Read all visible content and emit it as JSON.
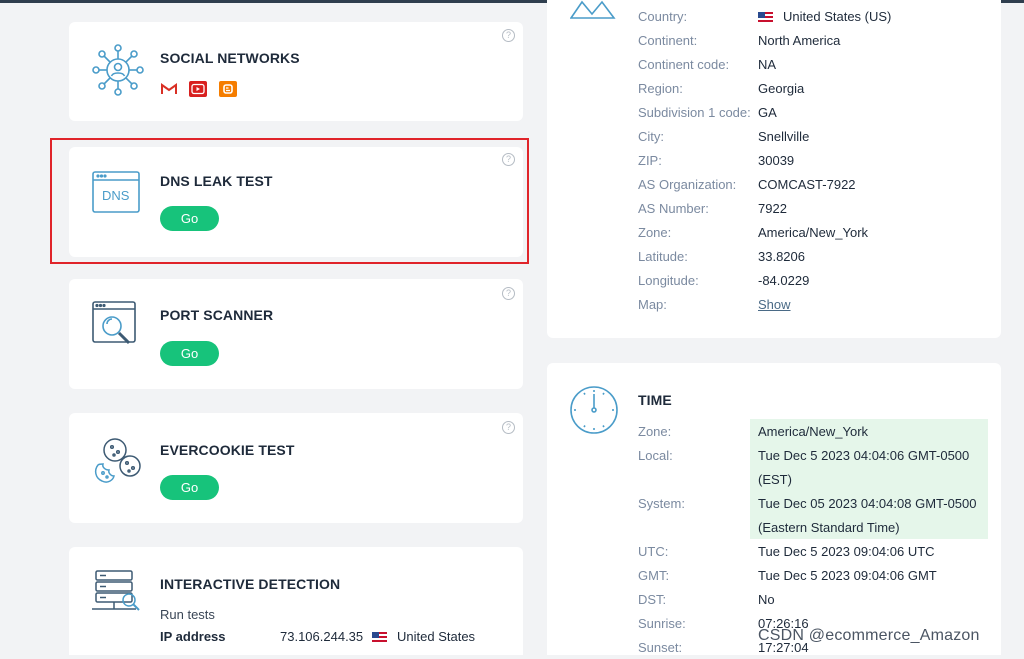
{
  "tools": {
    "social": {
      "title": "SOCIAL NETWORKS",
      "help": "?"
    },
    "dns": {
      "title": "DNS LEAK TEST",
      "icon_text": "DNS",
      "go": "Go",
      "help": "?"
    },
    "port": {
      "title": "PORT SCANNER",
      "go": "Go",
      "help": "?"
    },
    "evercookie": {
      "title": "EVERCOOKIE TEST",
      "go": "Go",
      "help": "?"
    },
    "interactive": {
      "title": "INTERACTIVE DETECTION",
      "subtitle": "Run tests",
      "ip_label": "IP address",
      "ip_value": "73.106.244.35",
      "ip_country": "United States"
    }
  },
  "location": {
    "rows": [
      {
        "label": "Country:",
        "value": "United States (US)"
      },
      {
        "label": "Continent:",
        "value": "North America"
      },
      {
        "label": "Continent code:",
        "value": "NA"
      },
      {
        "label": "Region:",
        "value": "Georgia"
      },
      {
        "label": "Subdivision 1 code:",
        "value": "GA"
      },
      {
        "label": "City:",
        "value": "Snellville"
      },
      {
        "label": "ZIP:",
        "value": "30039"
      },
      {
        "label": "AS Organization:",
        "value": "COMCAST-7922"
      },
      {
        "label": "AS Number:",
        "value": "7922"
      },
      {
        "label": "Zone:",
        "value": "America/New_York"
      },
      {
        "label": "Latitude:",
        "value": "33.8206"
      },
      {
        "label": "Longitude:",
        "value": "-84.0229"
      },
      {
        "label": "Map:",
        "value": "Show"
      }
    ]
  },
  "time": {
    "title": "TIME",
    "zone_label": "Zone:",
    "zone_value": "America/New_York",
    "local_label": "Local:",
    "local_value_1": "Tue Dec 5 2023 04:04:06 GMT-0500",
    "local_value_2": "(EST)",
    "system_label": "System:",
    "system_value_1": "Tue Dec 05 2023 04:04:08 GMT-0500",
    "system_value_2": "(Eastern Standard Time)",
    "utc_label": "UTC:",
    "utc_value": "Tue Dec 5 2023 09:04:06 UTC",
    "gmt_label": "GMT:",
    "gmt_value": "Tue Dec 5 2023 09:04:06 GMT",
    "dst_label": "DST:",
    "dst_value": "No",
    "sunrise_label": "Sunrise:",
    "sunrise_value": "07:26:16",
    "sunset_label": "Sunset:",
    "sunset_value": "17:27:04"
  },
  "watermark": "CSDN @ecommerce_Amazon",
  "colors": {
    "accent": "#17c37b",
    "highlight": "#e0242a",
    "icon": "#4a9cc9"
  }
}
